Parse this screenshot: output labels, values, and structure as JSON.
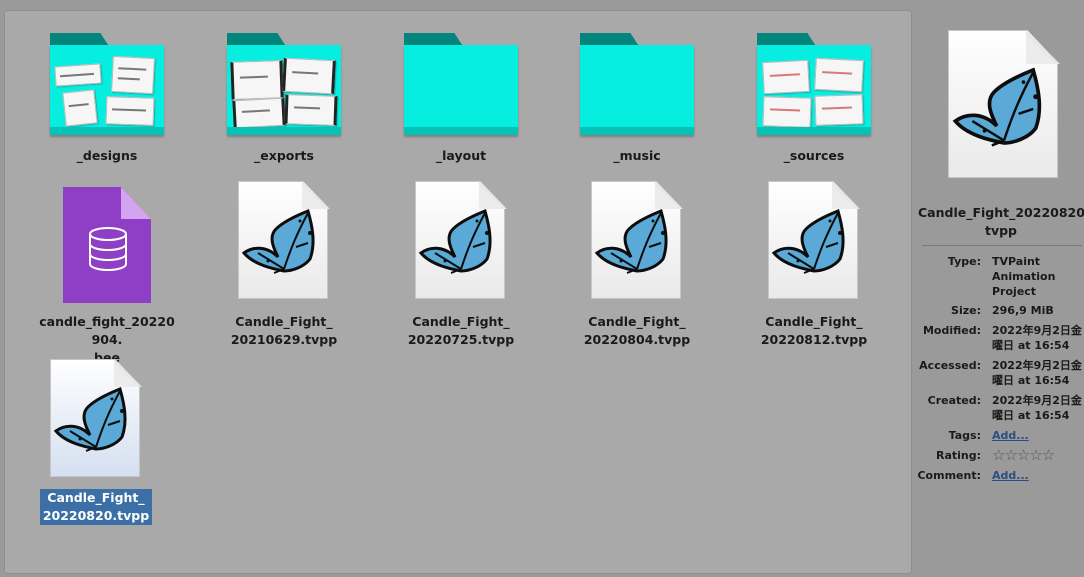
{
  "items": [
    {
      "kind": "folder",
      "name": "_designs",
      "variant": "designs"
    },
    {
      "kind": "folder",
      "name": "_exports",
      "variant": "exports"
    },
    {
      "kind": "folder",
      "name": "_layout",
      "variant": "empty"
    },
    {
      "kind": "folder",
      "name": "_music",
      "variant": "empty"
    },
    {
      "kind": "folder",
      "name": "_sources",
      "variant": "sources"
    },
    {
      "kind": "bee",
      "name_line1": "candle_fight_20220904.",
      "name_line2": "bee"
    },
    {
      "kind": "tvpp",
      "name_line1": "Candle_Fight_",
      "name_line2": "20210629.tvpp"
    },
    {
      "kind": "tvpp",
      "name_line1": "Candle_Fight_",
      "name_line2": "20220725.tvpp"
    },
    {
      "kind": "tvpp",
      "name_line1": "Candle_Fight_",
      "name_line2": "20220804.tvpp"
    },
    {
      "kind": "tvpp",
      "name_line1": "Candle_Fight_",
      "name_line2": "20220812.tvpp"
    },
    {
      "kind": "tvpp",
      "name_line1": "Candle_Fight_",
      "name_line2": "20220820.tvpp",
      "selected": true
    }
  ],
  "panel": {
    "title_line1": "Candle_Fight_20220820.",
    "title_line2": "tvpp",
    "type_label": "Type:",
    "type_value": [
      "TVPaint",
      "Animation",
      "Project"
    ],
    "size_label": "Size:",
    "size_value": "296,9 MiB",
    "modified_label": "Modified:",
    "modified_value": [
      "2022年9月2日金",
      "曜日 at 16:54"
    ],
    "accessed_label": "Accessed:",
    "accessed_value": [
      "2022年9月2日金",
      "曜日 at 16:54"
    ],
    "created_label": "Created:",
    "created_value": [
      "2022年9月2日金",
      "曜日 at 16:54"
    ],
    "tags_label": "Tags:",
    "tags_link": "Add...",
    "rating_label": "Rating:",
    "rating_stars": "☆☆☆☆☆",
    "comment_label": "Comment:",
    "comment_link": "Add..."
  },
  "colors": {
    "folder_body": "#05eee0",
    "folder_tab": "#04857c",
    "bee_icon": "#8f3fc6",
    "selection": "#3b6fa5",
    "butterfly": "#5aa9d6"
  }
}
